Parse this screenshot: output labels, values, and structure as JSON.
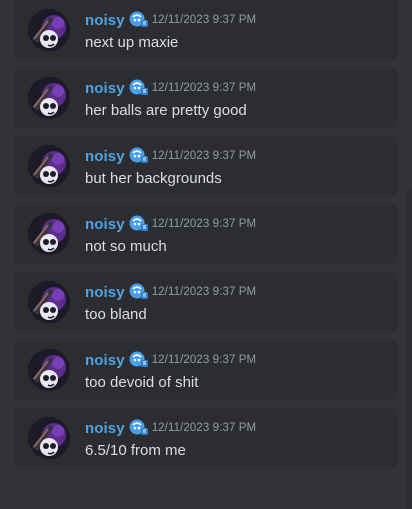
{
  "channel": {
    "messages": [
      {
        "author": "noisy",
        "timestamp": "12/11/2023 9:37 PM",
        "text": "next up maxie"
      },
      {
        "author": "noisy",
        "timestamp": "12/11/2023 9:37 PM",
        "text": "her balls are pretty good"
      },
      {
        "author": "noisy",
        "timestamp": "12/11/2023 9:37 PM",
        "text": "but her backgrounds"
      },
      {
        "author": "noisy",
        "timestamp": "12/11/2023 9:37 PM",
        "text": "not so much"
      },
      {
        "author": "noisy",
        "timestamp": "12/11/2023 9:37 PM",
        "text": "too bland"
      },
      {
        "author": "noisy",
        "timestamp": "12/11/2023 9:37 PM",
        "text": "too devoid of shit"
      },
      {
        "author": "noisy",
        "timestamp": "12/11/2023 9:37 PM",
        "text": "6.5/10 from me"
      }
    ]
  },
  "icons": {
    "avatar": "user-avatar",
    "badge": "role-badge-icon"
  },
  "colors": {
    "background": "#313338",
    "message_card": "#2b2d31",
    "username": "#4ea3e0",
    "timestamp": "#949ba4",
    "text": "#dbdee1"
  }
}
